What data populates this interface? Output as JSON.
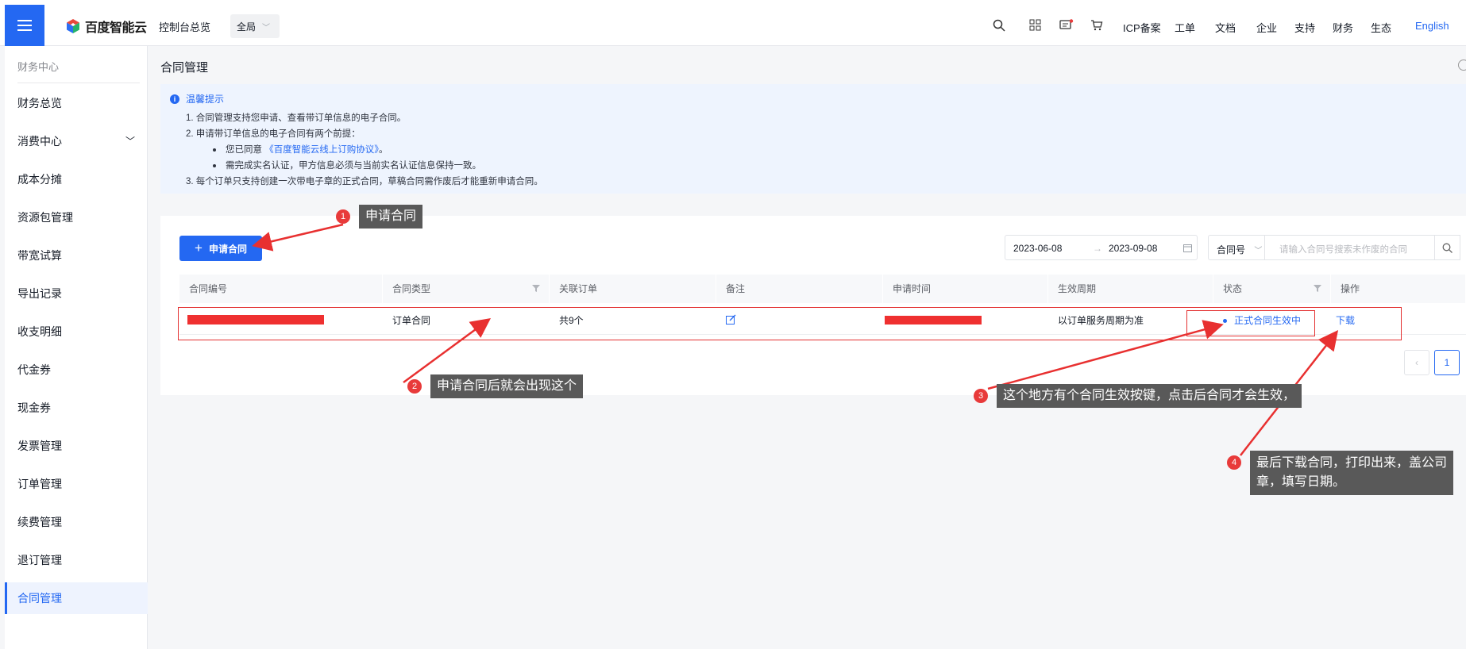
{
  "header": {
    "brand": "百度智能云",
    "console": "控制台总览",
    "region": "全局",
    "nav": [
      "ICP备案",
      "工单",
      "文档",
      "企业",
      "支持",
      "财务",
      "生态"
    ],
    "language": "English"
  },
  "sidebar": {
    "title": "财务中心",
    "items": [
      {
        "label": "财务总览"
      },
      {
        "label": "消费中心"
      },
      {
        "label": "成本分摊"
      },
      {
        "label": "资源包管理"
      },
      {
        "label": "带宽试算"
      },
      {
        "label": "导出记录"
      },
      {
        "label": "收支明细"
      },
      {
        "label": "代金券"
      },
      {
        "label": "现金券"
      },
      {
        "label": "发票管理"
      },
      {
        "label": "订单管理"
      },
      {
        "label": "续费管理"
      },
      {
        "label": "退订管理"
      },
      {
        "label": "合同管理"
      }
    ]
  },
  "page": {
    "title": "合同管理",
    "notice": {
      "title": "温馨提示",
      "line1": "1.  合同管理支持您申请、查看带订单信息的电子合同。",
      "line2": "2.  申请带订单信息的电子合同有两个前提：",
      "line3_prefix": "您已同意",
      "line3_link": "《百度智能云线上订购协议》",
      "line3_suffix": "。",
      "line4": "需完成实名认证，甲方信息必须与当前实名认证信息保持一致。",
      "line5": "3.  每个订单只支持创建一次带电子章的正式合同，草稿合同需作废后才能重新申请合同。"
    },
    "apply_button": "申请合同",
    "date_start": "2023-06-08",
    "date_arrow": "→",
    "date_end": "2023-09-08",
    "search_field": "合同号",
    "search_placeholder": "请输入合同号搜索未作废的合同",
    "table": {
      "headers": [
        "合同编号",
        "合同类型",
        "关联订单",
        "备注",
        "申请时间",
        "生效周期",
        "状态",
        "操作"
      ],
      "row": {
        "type": "订单合同",
        "orders": "共9个",
        "period": "以订单服务周期为准",
        "status": "正式合同生效中",
        "action": "下载"
      }
    },
    "pagination": {
      "current": "1"
    }
  },
  "annotations": [
    {
      "num": "1",
      "text": "申请合同"
    },
    {
      "num": "2",
      "text": "申请合同后就会出现这个"
    },
    {
      "num": "3",
      "text": "这个地方有个合同生效按键，点击后合同才会生效，"
    },
    {
      "num": "4",
      "line1": "最后下载合同，打印出来，盖公司",
      "line2": "章，填写日期。"
    }
  ]
}
